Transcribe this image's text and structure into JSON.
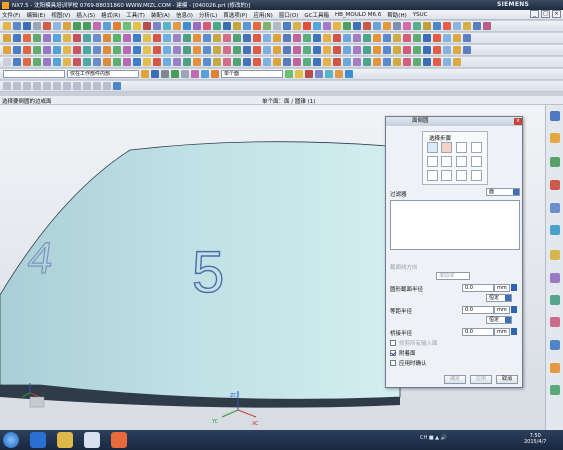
{
  "app": {
    "title": "NX7.5 - 沈阳模具培训学校 0769-88031860 WWW.MIZL.COM - 建模 - [040026.prt (修改的)]",
    "brand": "SIEMENS"
  },
  "menu": [
    "文件(F)",
    "编辑(E)",
    "视图(V)",
    "插入(S)",
    "格式(R)",
    "工具(T)",
    "装配(A)",
    "信息(I)",
    "分析(L)",
    "首选项(P)",
    "应用(N)",
    "窗口(O)",
    "GC工具箱",
    "HB_MOULD M6.6",
    "帮助(H)",
    "YSUC"
  ],
  "selection_bar": {
    "filter_value": "",
    "scope_value": "仅在工作部件内部",
    "curve_rule": "单个面"
  },
  "status": {
    "prompt": "选择要倒圆的边或面",
    "selection": "单个面：面 / 圆锥 (1)"
  },
  "viewport": {
    "numbers": [
      "5",
      "4"
    ],
    "axes": [
      "ZC",
      "YC",
      "XC"
    ]
  },
  "dialog": {
    "title": "面倒圆",
    "group_title": "选择步骤",
    "filter_label": "过滤器",
    "filter_value": "面",
    "section_method_label": "截面线方向",
    "section_method_value": "滚动球",
    "radius1": {
      "label": "圆形截面半径",
      "value": "0.0",
      "unit": "mm",
      "mode": "恒定"
    },
    "radius2": {
      "label": "等距半径",
      "value": "0.0",
      "unit": "mm",
      "mode": "恒定"
    },
    "radius3": {
      "label": "桥接半径",
      "value": "0.0",
      "unit": "mm"
    },
    "check1": {
      "label": "修剪所有输入面",
      "checked": false
    },
    "check2": {
      "label": "附着面",
      "checked": true
    },
    "check3": {
      "label": "应用时确认",
      "checked": false
    },
    "buttons": {
      "ok": "确定",
      "apply": "应用",
      "cancel": "取消"
    }
  },
  "taskbar": {
    "tray": "CH ■ ▲ 🔊",
    "time": "7:50",
    "date": "2015/4/7"
  }
}
